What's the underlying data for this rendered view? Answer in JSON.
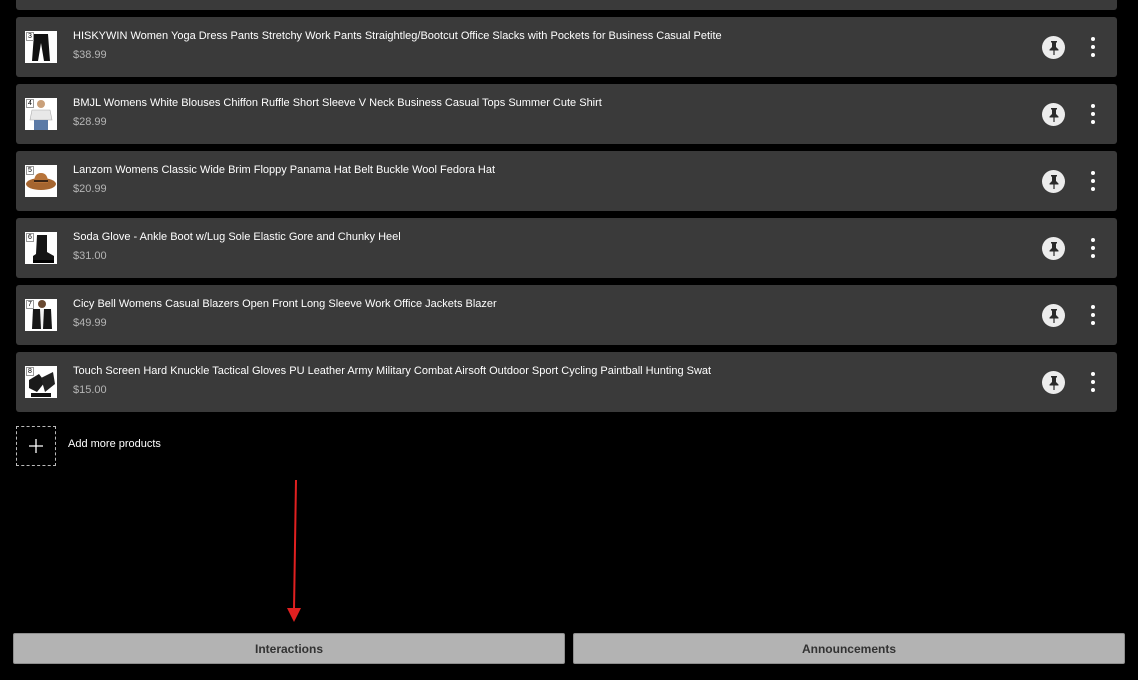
{
  "products": [
    {
      "index": "3",
      "title": "HISKYWIN Women Yoga Dress Pants Stretchy Work Pants Straightleg/Bootcut Office Slacks with Pockets for Business Casual Petite",
      "price": "$38.99",
      "image": "pants"
    },
    {
      "index": "4",
      "title": "BMJL Womens White Blouses Chiffon Ruffle Short Sleeve V Neck Business Casual Tops Summer Cute Shirt",
      "price": "$28.99",
      "image": "blouse"
    },
    {
      "index": "5",
      "title": "Lanzom Womens Classic Wide Brim Floppy Panama Hat Belt Buckle Wool Fedora Hat",
      "price": "$20.99",
      "image": "hat"
    },
    {
      "index": "6",
      "title": "Soda Glove - Ankle Boot w/Lug Sole Elastic Gore and Chunky Heel",
      "price": "$31.00",
      "image": "boot"
    },
    {
      "index": "7",
      "title": "Cicy Bell Womens Casual Blazers Open Front Long Sleeve Work Office Jackets Blazer",
      "price": "$49.99",
      "image": "blazer"
    },
    {
      "index": "8",
      "title": "Touch Screen Hard Knuckle Tactical Gloves PU Leather Army Military Combat Airsoft Outdoor Sport Cycling Paintball Hunting Swat",
      "price": "$15.00",
      "image": "gloves"
    }
  ],
  "row_icons": {
    "pin": "pin-icon",
    "menu": "more-vertical-icon"
  },
  "add_more": {
    "label": "Add more products",
    "icon": "plus-icon"
  },
  "tabs": {
    "interactions": "Interactions",
    "announcements": "Announcements"
  },
  "colors": {
    "row_bg": "#3a3a3a",
    "button_bg": "#b3b3b3",
    "arrow": "#e02020"
  }
}
